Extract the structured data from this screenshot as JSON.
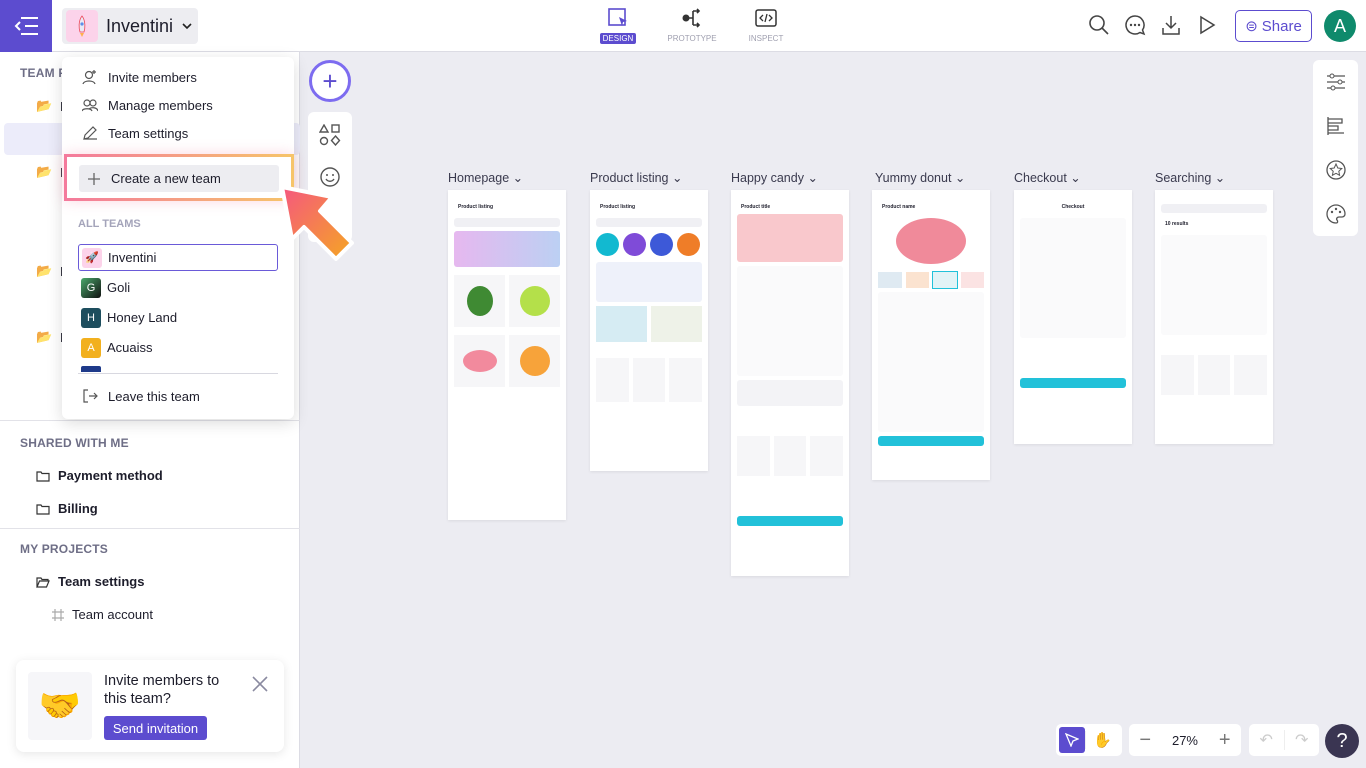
{
  "header": {
    "team_name": "Inventini",
    "modes": [
      {
        "label": "DESIGN",
        "active": true
      },
      {
        "label": "PROTOTYPE"
      },
      {
        "label": "INSPECT"
      }
    ],
    "share_label": "Share",
    "avatar_initial": "A",
    "accent": "#5c4ccf"
  },
  "sidebar": {
    "team_section_partial": "TEAM P",
    "hidden_rows": [
      "D",
      "D",
      "P",
      "P"
    ],
    "shared_title": "SHARED WITH ME",
    "shared": [
      "Payment method",
      "Billing"
    ],
    "my_projects_title": "MY PROJECTS",
    "project": "Team settings",
    "project_child": "Team account"
  },
  "dropdown": {
    "items": [
      "Invite members",
      "Manage members",
      "Team settings"
    ],
    "create_label": "Create a new team",
    "all_teams_title": "ALL TEAMS",
    "teams": [
      {
        "name": "Inventini",
        "initial": "",
        "color": "#fcd3ea",
        "selected": true
      },
      {
        "name": "Goli",
        "initial": "G",
        "color": "#2f6b4f"
      },
      {
        "name": "Honey Land",
        "initial": "H",
        "color": "#1d4e5e"
      },
      {
        "name": "Acuaiss",
        "initial": "A",
        "color": "#f2b01e"
      }
    ],
    "leave_label": "Leave this team"
  },
  "invite_card": {
    "title": "Invite members to this team?",
    "button": "Send invitation"
  },
  "frames": [
    {
      "label": "Homepage",
      "title": "Product listing"
    },
    {
      "label": "Product listing",
      "title": "Product listing"
    },
    {
      "label": "Happy candy",
      "title": "Product title"
    },
    {
      "label": "Yummy donut",
      "title": "Product name"
    },
    {
      "label": "Checkout",
      "title": "Checkout"
    },
    {
      "label": "Searching",
      "title": "10 results"
    }
  ],
  "zoom": {
    "level": "27%"
  },
  "help_label": "?"
}
